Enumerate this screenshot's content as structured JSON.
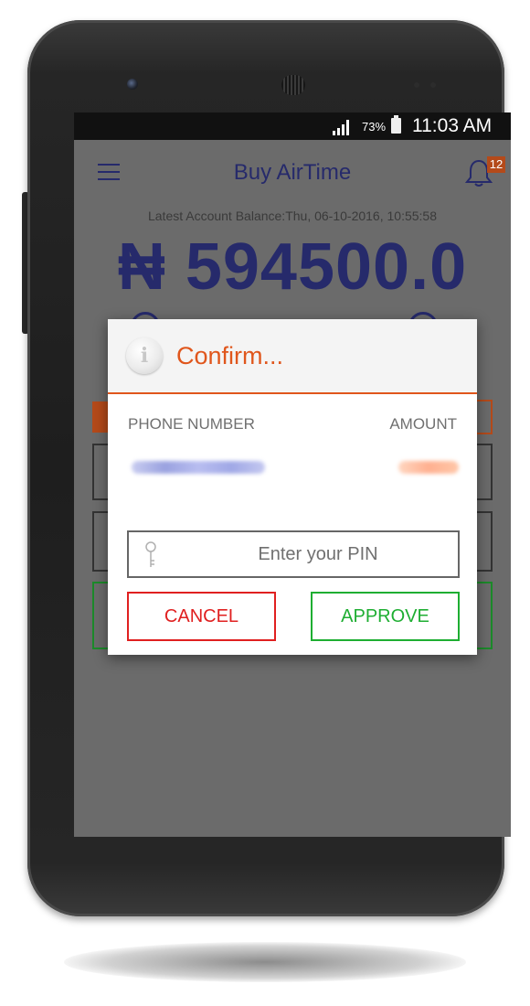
{
  "status_bar": {
    "battery": "73%",
    "time": "11:03 AM"
  },
  "app_bar": {
    "title": "Buy AirTime",
    "notification_count": "12"
  },
  "account": {
    "balance_label": "Latest Account Balance:Thu, 06-10-2016, 10:55:58",
    "balance": "₦ 594500.0"
  },
  "dialog": {
    "title": "Confirm...",
    "phone_header": "PHONE NUMBER",
    "amount_header": "AMOUNT",
    "pin_placeholder": "Enter your PIN",
    "cancel_label": "CANCEL",
    "approve_label": "APPROVE"
  },
  "colors": {
    "brand_navy": "#262a6b",
    "accent_orange": "#e0561c",
    "cancel_red": "#e02020",
    "approve_green": "#1eae32"
  },
  "icons": [
    "menu-icon",
    "bell-icon",
    "info-icon",
    "key-icon",
    "signal-icon",
    "battery-icon"
  ]
}
